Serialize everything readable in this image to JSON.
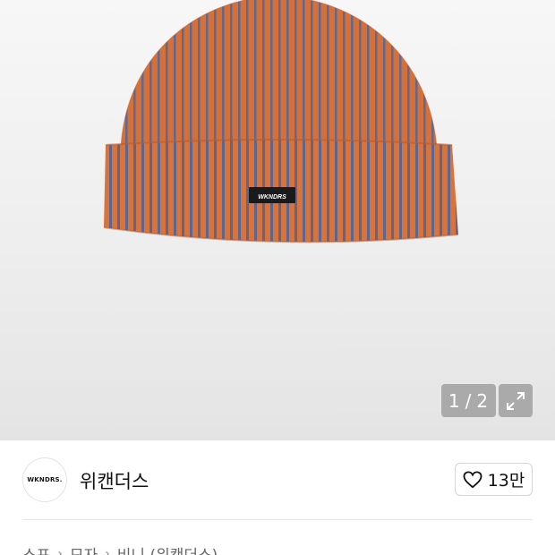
{
  "gallery": {
    "current": "1",
    "separator": "/",
    "total": "2",
    "colors": {
      "knit_orange": "#d9733c",
      "knit_blue": "#5b6790",
      "label_bg": "#1a1a1a"
    },
    "label_text": "WKNDRS"
  },
  "brand": {
    "logo_text": "WKNDRS.",
    "name": "위캔더스",
    "like_count": "13만"
  },
  "breadcrumb": {
    "items": [
      "스포",
      "모자",
      "비니 (위캔더스)"
    ]
  }
}
